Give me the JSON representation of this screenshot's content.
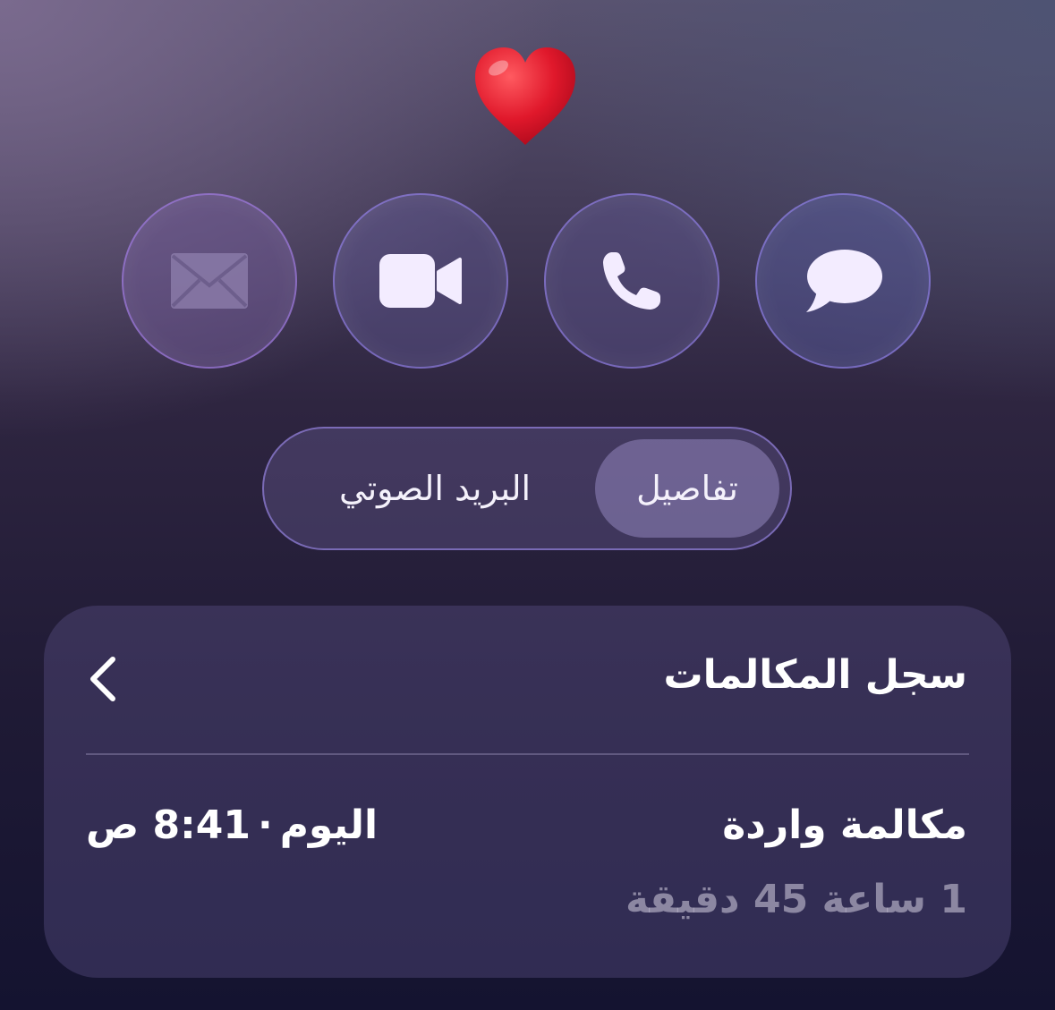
{
  "header": {
    "contact_emoji": "❤️"
  },
  "actions": {
    "mail_label": "mail",
    "video_label": "video",
    "phone_label": "call",
    "message_label": "message"
  },
  "tabs": {
    "details_label": "تفاصيل",
    "voicemail_label": "البريد الصوتي",
    "selected": "details"
  },
  "call_log": {
    "title": "سجل المكالمات",
    "entries": [
      {
        "type": "مكالمة واردة",
        "day": "اليوم",
        "separator": "·",
        "time": "8:41 ص",
        "duration": "1 ساعة 45 دقيقة"
      }
    ]
  },
  "colors": {
    "heart": "#e0182b",
    "icon_fill": "#f3ecff",
    "accent_border": "#a08cff"
  }
}
